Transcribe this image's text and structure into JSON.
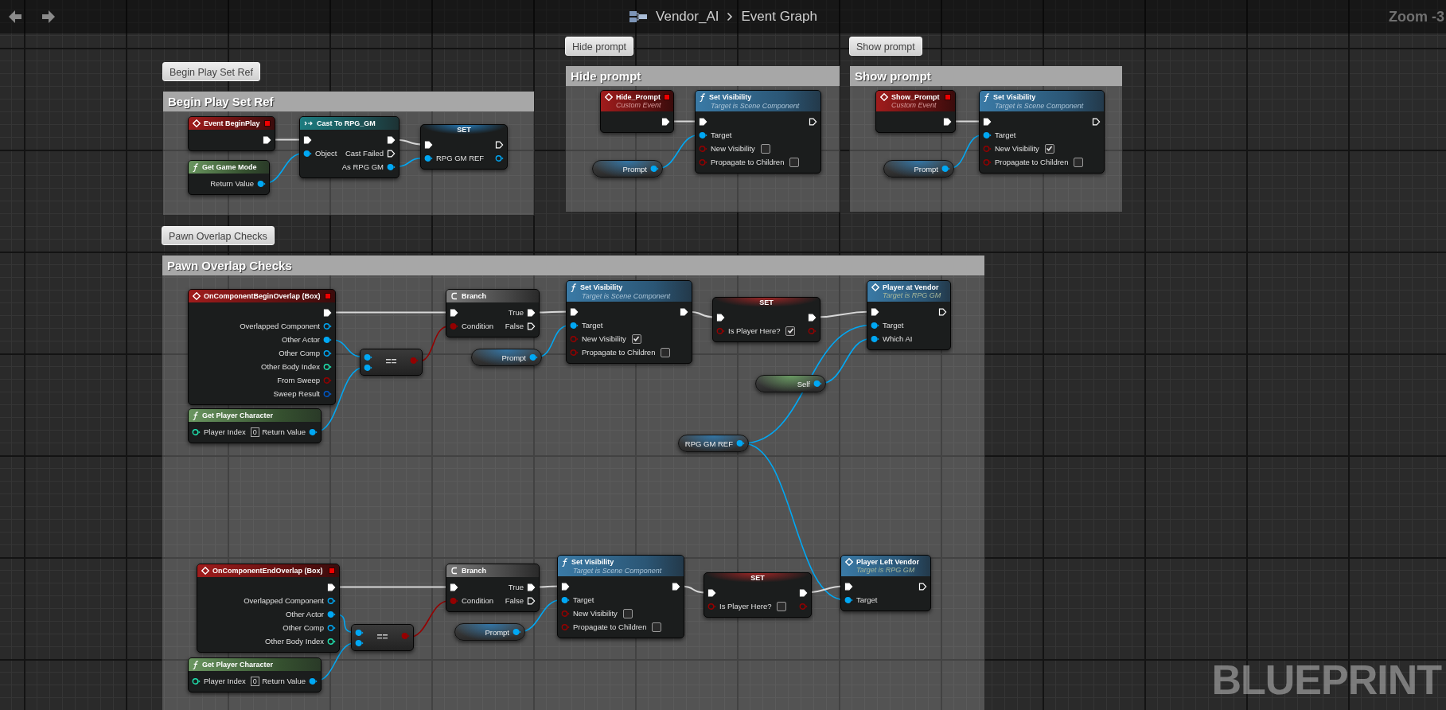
{
  "toolbar": {
    "breadcrumb": [
      "Vendor_AI",
      "Event Graph"
    ],
    "zoom": "Zoom -3"
  },
  "comments": [
    {
      "bubble": "Begin Play Set Ref",
      "title": "Begin Play Set Ref"
    },
    {
      "bubble": "Hide prompt",
      "title": "Hide prompt"
    },
    {
      "bubble": "Show prompt",
      "title": "Show prompt"
    },
    {
      "bubble": "Pawn Overlap Checks",
      "title": "Pawn Overlap Checks"
    }
  ],
  "nodes": [
    {
      "kind": "event",
      "title": "Event BeginPlay",
      "rows": [
        {
          "out": {
            "kind": "exec",
            "connected": true
          }
        }
      ]
    },
    {
      "kind": "pure",
      "title": "Get Game Mode",
      "rows": [
        {
          "out": {
            "kind": "object",
            "label": "Return Value",
            "connected": true
          }
        }
      ]
    },
    {
      "kind": "cast",
      "title": "Cast To RPG_GM",
      "rows": [
        {
          "in": {
            "kind": "exec",
            "connected": true
          },
          "out": {
            "kind": "exec",
            "connected": true
          }
        },
        {
          "in": {
            "kind": "object",
            "label": "Object",
            "connected": true
          },
          "out": {
            "kind": "exec",
            "label": "Cast Failed",
            "connected": false
          }
        },
        {
          "out": {
            "kind": "object",
            "label": "As RPG GM",
            "connected": true
          }
        }
      ]
    },
    {
      "kind": "set",
      "title": "SET",
      "rows": [
        {
          "in": {
            "kind": "exec",
            "connected": true
          },
          "out": {
            "kind": "exec",
            "connected": false
          }
        },
        {
          "in": {
            "kind": "object",
            "label": "RPG GM REF",
            "connected": true
          },
          "out": {
            "kind": "object",
            "connected": false
          }
        }
      ]
    },
    {
      "kind": "event",
      "title": "Hide_Prompt",
      "subtitle": "Custom Event",
      "rows": [
        {
          "out": {
            "kind": "exec",
            "connected": true
          }
        }
      ]
    },
    {
      "kind": "call",
      "title": "Set Visibility",
      "subtitle": "Target is Scene Component",
      "rows": [
        {
          "in": {
            "kind": "exec",
            "connected": true
          },
          "out": {
            "kind": "exec",
            "connected": false
          }
        },
        {
          "in": {
            "kind": "object",
            "label": "Target",
            "connected": true
          }
        },
        {
          "in": {
            "kind": "bool",
            "label": "New Visibility",
            "connected": false,
            "field": {
              "kind": "checkbox",
              "checked": false
            }
          }
        },
        {
          "in": {
            "kind": "bool",
            "label": "Propagate to Children",
            "connected": false,
            "field": {
              "kind": "checkbox",
              "checked": false
            }
          }
        }
      ]
    },
    {
      "kind": "variable",
      "title": "Prompt",
      "rows": [
        {
          "out": {
            "kind": "object",
            "connected": true
          }
        }
      ]
    },
    {
      "kind": "event",
      "title": "Show_Prompt",
      "subtitle": "Custom Event",
      "rows": [
        {
          "out": {
            "kind": "exec",
            "connected": true
          }
        }
      ]
    },
    {
      "kind": "call",
      "title": "Set Visibility",
      "subtitle": "Target is Scene Component",
      "rows": [
        {
          "in": {
            "kind": "exec",
            "connected": true
          },
          "out": {
            "kind": "exec",
            "connected": false
          }
        },
        {
          "in": {
            "kind": "object",
            "label": "Target",
            "connected": true
          }
        },
        {
          "in": {
            "kind": "bool",
            "label": "New Visibility",
            "connected": false,
            "field": {
              "kind": "checkbox",
              "checked": true
            }
          }
        },
        {
          "in": {
            "kind": "bool",
            "label": "Propagate to Children",
            "connected": false,
            "field": {
              "kind": "checkbox",
              "checked": false
            }
          }
        }
      ]
    },
    {
      "kind": "variable",
      "title": "Prompt",
      "rows": [
        {
          "out": {
            "kind": "object",
            "connected": true
          }
        }
      ]
    },
    {
      "kind": "event",
      "title": "OnComponentBeginOverlap (Box)",
      "rows": [
        {
          "out": {
            "kind": "exec",
            "connected": true
          }
        },
        {
          "out": {
            "kind": "object",
            "label": "Overlapped Component",
            "connected": false
          }
        },
        {
          "out": {
            "kind": "object",
            "label": "Other Actor",
            "connected": true
          }
        },
        {
          "out": {
            "kind": "object",
            "label": "Other Comp",
            "connected": false
          }
        },
        {
          "out": {
            "kind": "int",
            "label": "Other Body Index",
            "connected": false
          }
        },
        {
          "out": {
            "kind": "bool",
            "label": "From Sweep",
            "connected": false
          }
        },
        {
          "out": {
            "kind": "struct",
            "label": "Sweep Result",
            "connected": false
          }
        }
      ]
    },
    {
      "kind": "pure",
      "title": "Get Player Character",
      "rows": [
        {
          "in": {
            "kind": "int",
            "label": "Player Index",
            "connected": false,
            "field": {
              "kind": "number",
              "value": "0"
            }
          },
          "out": {
            "kind": "object",
            "label": "Return Value",
            "connected": true
          }
        }
      ]
    },
    {
      "kind": "compare",
      "title": "==",
      "rows": [
        {
          "in": {
            "kind": "object",
            "connected": true
          },
          "out": {
            "kind": "bool",
            "connected": true
          }
        },
        {
          "in": {
            "kind": "object",
            "connected": true
          }
        }
      ]
    },
    {
      "kind": "branch",
      "title": "Branch",
      "rows": [
        {
          "in": {
            "kind": "exec",
            "connected": true
          },
          "out": {
            "kind": "exec",
            "label": "True",
            "connected": true
          }
        },
        {
          "in": {
            "kind": "bool",
            "label": "Condition",
            "connected": true
          },
          "out": {
            "kind": "exec",
            "label": "False",
            "connected": false
          }
        }
      ]
    },
    {
      "kind": "variable",
      "title": "Prompt",
      "rows": [
        {
          "out": {
            "kind": "object",
            "connected": true
          }
        }
      ]
    },
    {
      "kind": "call",
      "title": "Set Visibility",
      "subtitle": "Target is Scene Component",
      "rows": [
        {
          "in": {
            "kind": "exec",
            "connected": true
          },
          "out": {
            "kind": "exec",
            "connected": true
          }
        },
        {
          "in": {
            "kind": "object",
            "label": "Target",
            "connected": true
          }
        },
        {
          "in": {
            "kind": "bool",
            "label": "New Visibility",
            "connected": false,
            "field": {
              "kind": "checkbox",
              "checked": true
            }
          }
        },
        {
          "in": {
            "kind": "bool",
            "label": "Propagate to Children",
            "connected": false,
            "field": {
              "kind": "checkbox",
              "checked": false
            }
          }
        }
      ]
    },
    {
      "kind": "set",
      "title": "SET",
      "rows": [
        {
          "in": {
            "kind": "exec",
            "connected": true
          },
          "out": {
            "kind": "exec",
            "connected": true
          }
        },
        {
          "in": {
            "kind": "bool",
            "label": "Is Player Here?",
            "connected": false,
            "field": {
              "kind": "checkbox",
              "checked": true
            }
          },
          "out": {
            "kind": "bool",
            "connected": false
          }
        }
      ]
    },
    {
      "kind": "self",
      "title": "Self",
      "rows": [
        {
          "out": {
            "kind": "object",
            "connected": true
          }
        }
      ]
    },
    {
      "kind": "variable",
      "title": "RPG GM REF",
      "rows": [
        {
          "out": {
            "kind": "object",
            "connected": true
          }
        }
      ]
    },
    {
      "kind": "message",
      "title": "Player at Vendor",
      "subtitle": "Target is RPG GM",
      "rows": [
        {
          "in": {
            "kind": "exec",
            "connected": true
          },
          "out": {
            "kind": "exec",
            "connected": false
          }
        },
        {
          "in": {
            "kind": "object",
            "label": "Target",
            "connected": true
          }
        },
        {
          "in": {
            "kind": "object",
            "label": "Which AI",
            "connected": true
          }
        }
      ]
    },
    {
      "kind": "event",
      "title": "OnComponentEndOverlap (Box)",
      "rows": [
        {
          "out": {
            "kind": "exec",
            "connected": true
          }
        },
        {
          "out": {
            "kind": "object",
            "label": "Overlapped Component",
            "connected": false
          }
        },
        {
          "out": {
            "kind": "object",
            "label": "Other Actor",
            "connected": true
          }
        },
        {
          "out": {
            "kind": "object",
            "label": "Other Comp",
            "connected": false
          }
        },
        {
          "out": {
            "kind": "int",
            "label": "Other Body Index",
            "connected": false
          }
        }
      ]
    },
    {
      "kind": "pure",
      "title": "Get Player Character",
      "rows": [
        {
          "in": {
            "kind": "int",
            "label": "Player Index",
            "connected": false,
            "field": {
              "kind": "number",
              "value": "0"
            }
          },
          "out": {
            "kind": "object",
            "label": "Return Value",
            "connected": true
          }
        }
      ]
    },
    {
      "kind": "compare",
      "title": "==",
      "rows": [
        {
          "in": {
            "kind": "object",
            "connected": true
          },
          "out": {
            "kind": "bool",
            "connected": true
          }
        },
        {
          "in": {
            "kind": "object",
            "connected": true
          }
        }
      ]
    },
    {
      "kind": "branch",
      "title": "Branch",
      "rows": [
        {
          "in": {
            "kind": "exec",
            "connected": true
          },
          "out": {
            "kind": "exec",
            "label": "True",
            "connected": true
          }
        },
        {
          "in": {
            "kind": "bool",
            "label": "Condition",
            "connected": true
          },
          "out": {
            "kind": "exec",
            "label": "False",
            "connected": false
          }
        }
      ]
    },
    {
      "kind": "variable",
      "title": "Prompt",
      "rows": [
        {
          "out": {
            "kind": "object",
            "connected": true
          }
        }
      ]
    },
    {
      "kind": "call",
      "title": "Set Visibility",
      "subtitle": "Target is Scene Component",
      "rows": [
        {
          "in": {
            "kind": "exec",
            "connected": true
          },
          "out": {
            "kind": "exec",
            "connected": true
          }
        },
        {
          "in": {
            "kind": "object",
            "label": "Target",
            "connected": true
          }
        },
        {
          "in": {
            "kind": "bool",
            "label": "New Visibility",
            "connected": false,
            "field": {
              "kind": "checkbox",
              "checked": false
            }
          }
        },
        {
          "in": {
            "kind": "bool",
            "label": "Propagate to Children",
            "connected": false,
            "field": {
              "kind": "checkbox",
              "checked": false
            }
          }
        }
      ]
    },
    {
      "kind": "set",
      "title": "SET",
      "rows": [
        {
          "in": {
            "kind": "exec",
            "connected": true
          },
          "out": {
            "kind": "exec",
            "connected": true
          }
        },
        {
          "in": {
            "kind": "bool",
            "label": "Is Player Here?",
            "connected": false,
            "field": {
              "kind": "checkbox",
              "checked": false
            }
          },
          "out": {
            "kind": "bool",
            "connected": false
          }
        }
      ]
    },
    {
      "kind": "message",
      "title": "Player Left Vendor",
      "subtitle": "Target is RPG GM",
      "rows": [
        {
          "in": {
            "kind": "exec",
            "connected": true
          },
          "out": {
            "kind": "exec",
            "connected": false
          }
        },
        {
          "in": {
            "kind": "object",
            "label": "Target",
            "connected": true
          }
        }
      ]
    }
  ],
  "watermark": "BLUEPRINT"
}
